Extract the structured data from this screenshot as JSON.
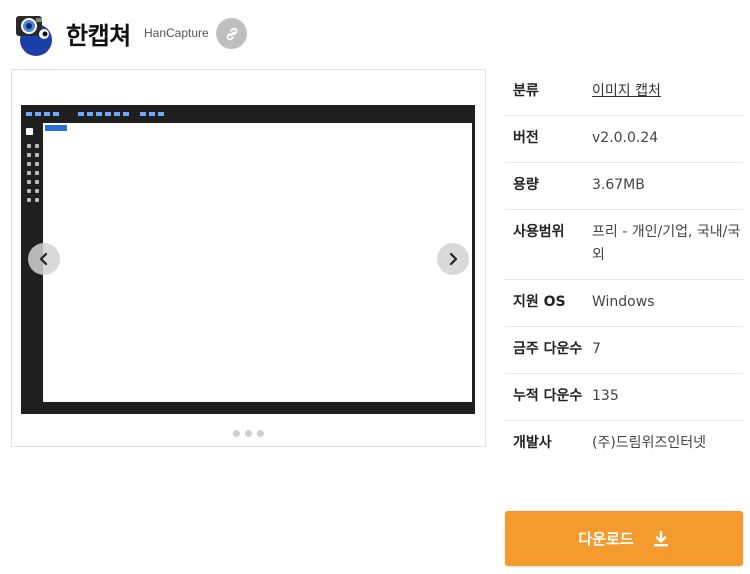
{
  "app": {
    "title": "한캡쳐",
    "subtitle": "HanCapture",
    "icon": "camera-mascot-icon",
    "link_icon": "link-icon"
  },
  "slider": {
    "prev_icon": "chevron-left-icon",
    "next_icon": "chevron-right-icon",
    "dot_count": 3
  },
  "info": {
    "rows": [
      {
        "label": "분류",
        "value": "이미지 캡처"
      },
      {
        "label": "버전",
        "value": "v2.0.0.24"
      },
      {
        "label": "용량",
        "value": "3.67MB"
      },
      {
        "label": "사용범위",
        "value": "프리 - 개인/기업, 국내/국외"
      },
      {
        "label": "지원 OS",
        "value": "Windows"
      },
      {
        "label": "금주 다운수",
        "value": "7"
      },
      {
        "label": "누적 다운수",
        "value": "135"
      },
      {
        "label": "개발사",
        "value": "(주)드림위즈인터넷"
      }
    ]
  },
  "download": {
    "label": "다운로드",
    "icon": "download-icon"
  },
  "colors": {
    "accent": "#f59a2c",
    "link_button_bg": "#bfbfbf"
  }
}
